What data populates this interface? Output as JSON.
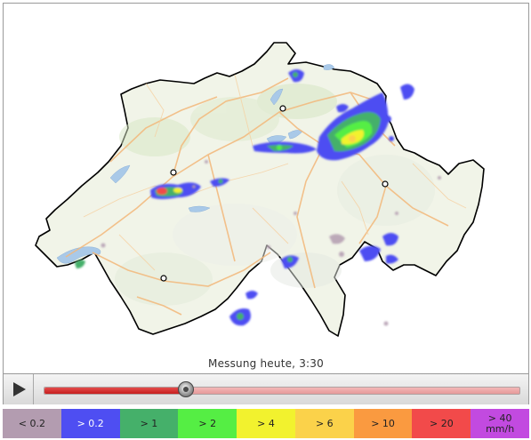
{
  "timestamp": "Messung heute, 3:30",
  "player": {
    "progress": 0.3
  },
  "legend": [
    {
      "label": "< 0.2",
      "color": "#b39cb0",
      "text_color": "#222222"
    },
    {
      "label": "> 0.2",
      "color": "#4e4ef2",
      "text_color": "#ffffff"
    },
    {
      "label": "> 1",
      "color": "#45b06a",
      "text_color": "#222222"
    },
    {
      "label": "> 2",
      "color": "#55ee44",
      "text_color": "#222222"
    },
    {
      "label": "> 4",
      "color": "#f2f22e",
      "text_color": "#222222"
    },
    {
      "label": "> 6",
      "color": "#fbd24a",
      "text_color": "#222222"
    },
    {
      "label": "> 10",
      "color": "#fa9a40",
      "text_color": "#222222"
    },
    {
      "label": "> 20",
      "color": "#f24a4a",
      "text_color": "#222222"
    },
    {
      "label": "> 40\nmm/h",
      "color": "#c24ae0",
      "text_color": "#222222"
    }
  ]
}
